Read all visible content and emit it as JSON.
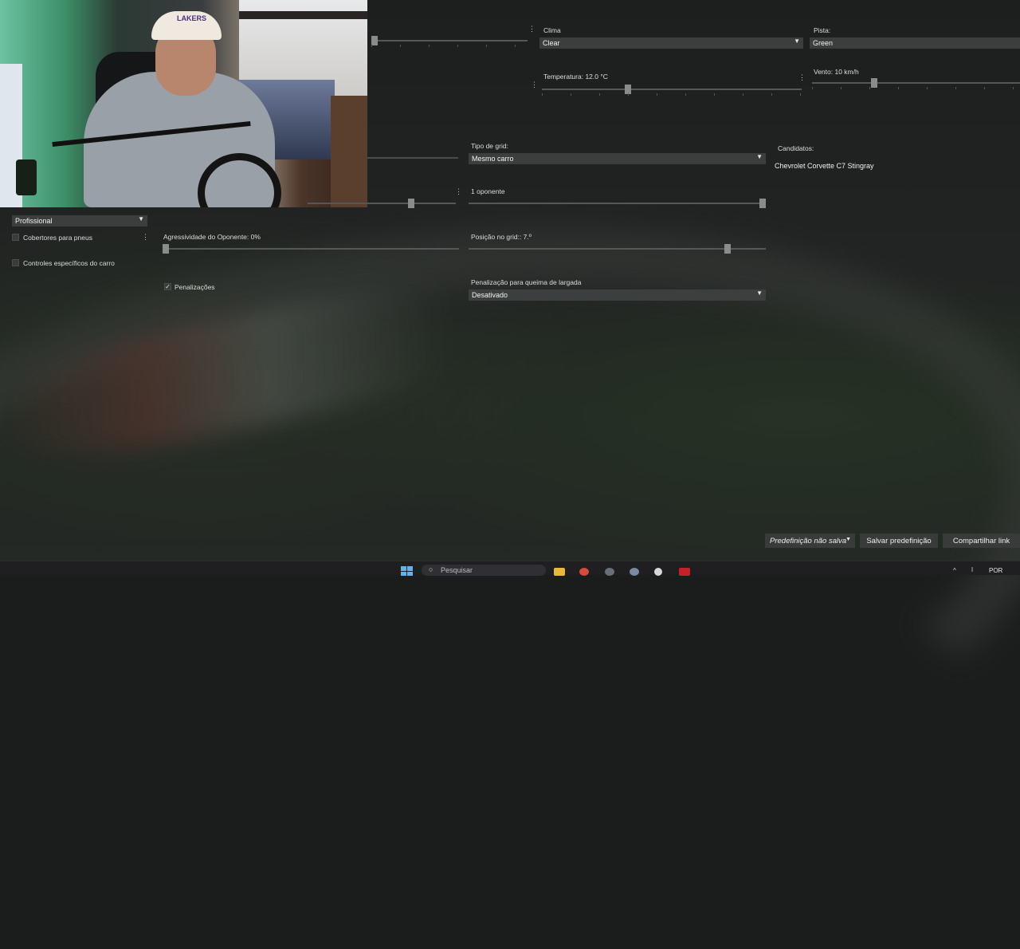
{
  "weather": {
    "clima_label": "Clima",
    "clima_value": "Clear",
    "pista_label": "Pista:",
    "pista_value": "Green",
    "temperatura_label": "Temperatura: 12.0 °C",
    "temperatura_fraction": 0.33,
    "vento_label": "Vento: 10 km/h",
    "vento_fraction": 0.3,
    "top_slider_fraction": 0.02
  },
  "grid": {
    "tipo_label": "Tipo de grid:",
    "tipo_value": "Mesmo carro",
    "candidatos_label": "Candidatos:",
    "candidatos_value": "Chevrolet Corvette C7 Stingray",
    "opponents_label": "1 oponente",
    "opponents_fraction": 1.0,
    "left_slider_fraction": 0.7,
    "posicao_label": "Posição no grid:: 7.º",
    "posicao_fraction": 0.87
  },
  "assists": {
    "difficulty_value": "Profissional",
    "cobertores_label": "Cobertores para pneus",
    "cobertores_checked": false,
    "controles_label": "Controles específicos do carro",
    "controles_checked": false,
    "agressividade_label": "Agressividade do Oponente: 0%",
    "agressividade_fraction": 0.0,
    "penalizacoes_label": "Penalizações",
    "penalizacoes_checked": true,
    "checkmark": "✓",
    "queima_label": "Penalização para queima de largada",
    "queima_value": "Desativado"
  },
  "footer": {
    "preset_label": "Predefinição não salva",
    "save_label": "Salvar predefinição",
    "share_label": "Compartilhar link"
  },
  "taskbar": {
    "search_placeholder": "Pesquisar",
    "language": "POR",
    "icons": [
      "windows-icon",
      "file-explorer-icon",
      "chrome-icon",
      "app-icon",
      "settings-icon",
      "logitech-icon",
      "game-icon"
    ]
  },
  "webcam": {
    "cap_text": "LAKERS"
  },
  "colors": {
    "select_bg": "#3e4040",
    "accent_windows": "#5cb5f0"
  }
}
